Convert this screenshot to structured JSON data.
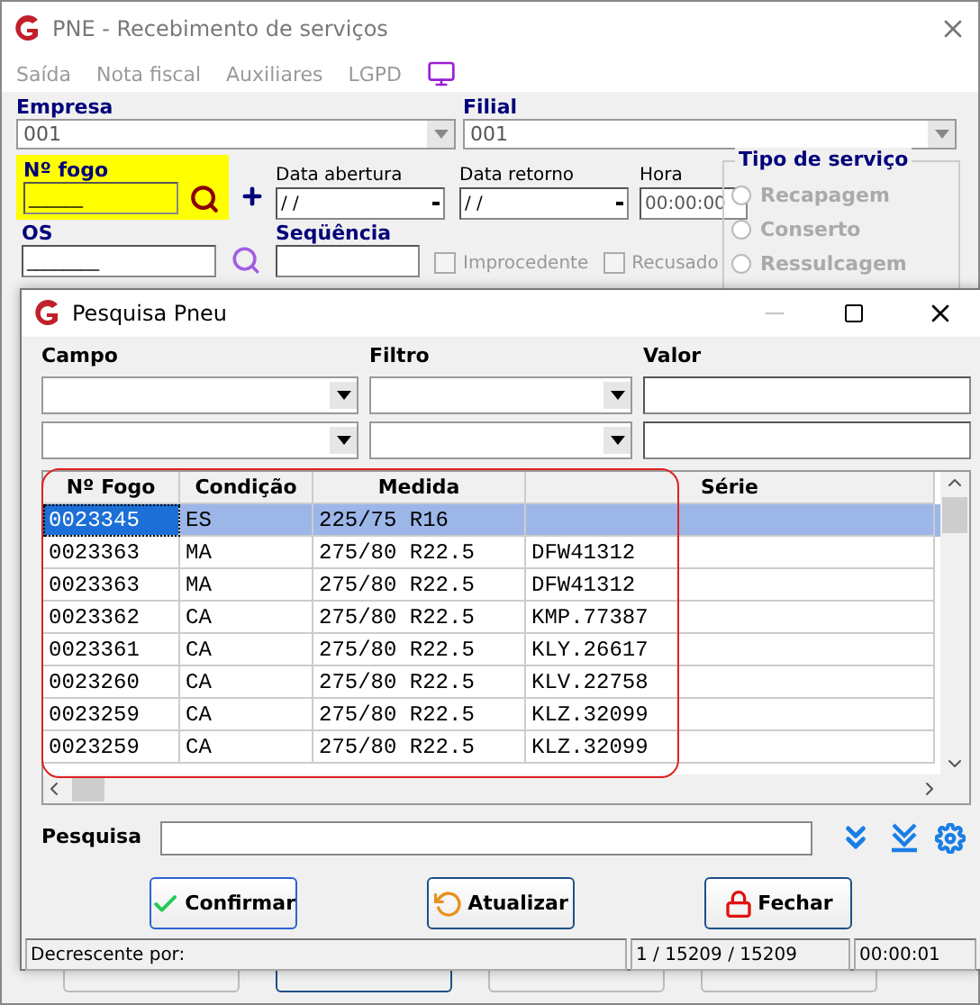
{
  "window": {
    "title": "PNE - Recebimento de serviços"
  },
  "menu": [
    {
      "label": "Saída",
      "disabled": true
    },
    {
      "label": "Nota fiscal",
      "disabled": true
    },
    {
      "label": "Auxiliares",
      "disabled": true
    },
    {
      "label": "LGPD",
      "disabled": true
    }
  ],
  "form": {
    "empresa": {
      "label": "Empresa",
      "value": "001"
    },
    "filial": {
      "label": "Filial",
      "value": "001"
    },
    "fogo": {
      "label": "Nº  fogo",
      "value": "______"
    },
    "data_abertura": {
      "label": "Data abertura",
      "value": " /  /"
    },
    "data_retorno": {
      "label": "Data retorno",
      "value": " /  /"
    },
    "hora": {
      "label": "Hora",
      "value": "00:00:00"
    },
    "os": {
      "label": "OS",
      "value": "________"
    },
    "sequencia": {
      "label": "Seqüência"
    },
    "checks": [
      {
        "label": "Improcedente",
        "checked": false,
        "disabled": true
      },
      {
        "label": "Recusado",
        "checked": false,
        "disabled": true
      }
    ],
    "tipo_servico": {
      "title": "Tipo de serviço",
      "options": [
        {
          "label": "Recapagem",
          "selected": false
        },
        {
          "label": "Conserto",
          "selected": false
        },
        {
          "label": "Ressulcagem",
          "selected": false
        }
      ]
    }
  },
  "dialog": {
    "title": "Pesquisa Pneu",
    "filters": {
      "labels": [
        "Campo",
        "Filtro",
        "Valor"
      ]
    },
    "table": {
      "columns": [
        "Nº Fogo",
        "Condição",
        "Medida",
        "Série"
      ],
      "rows": [
        {
          "cells": [
            "0023345",
            "ES",
            "225/75 R16",
            ""
          ],
          "selected": true
        },
        {
          "cells": [
            "0023363",
            "MA",
            "275/80 R22.5",
            "DFW41312"
          ],
          "selected": false
        },
        {
          "cells": [
            "0023363",
            "MA",
            "275/80 R22.5",
            "DFW41312"
          ],
          "selected": false
        },
        {
          "cells": [
            "0023362",
            "CA",
            "275/80 R22.5",
            "KMP.77387"
          ],
          "selected": false
        },
        {
          "cells": [
            "0023361",
            "CA",
            "275/80 R22.5",
            "KLY.26617"
          ],
          "selected": false
        },
        {
          "cells": [
            "0023260",
            "CA",
            "275/80 R22.5",
            "KLV.22758"
          ],
          "selected": false
        },
        {
          "cells": [
            "0023259",
            "CA",
            "275/80 R22.5",
            "KLZ.32099"
          ],
          "selected": false
        },
        {
          "cells": [
            "0023259",
            "CA",
            "275/80 R22.5",
            "KLZ.32099"
          ],
          "selected": false
        }
      ]
    },
    "search": {
      "label": "Pesquisa"
    },
    "buttons": [
      {
        "label": "Confirmar",
        "kind": "confirm"
      },
      {
        "label": "Atualizar",
        "kind": "refresh"
      },
      {
        "label": "Fechar",
        "kind": "close"
      }
    ],
    "status_bar": [
      "Decrescente por:",
      "1 / 15209 / 15209",
      "00:00:01"
    ]
  }
}
